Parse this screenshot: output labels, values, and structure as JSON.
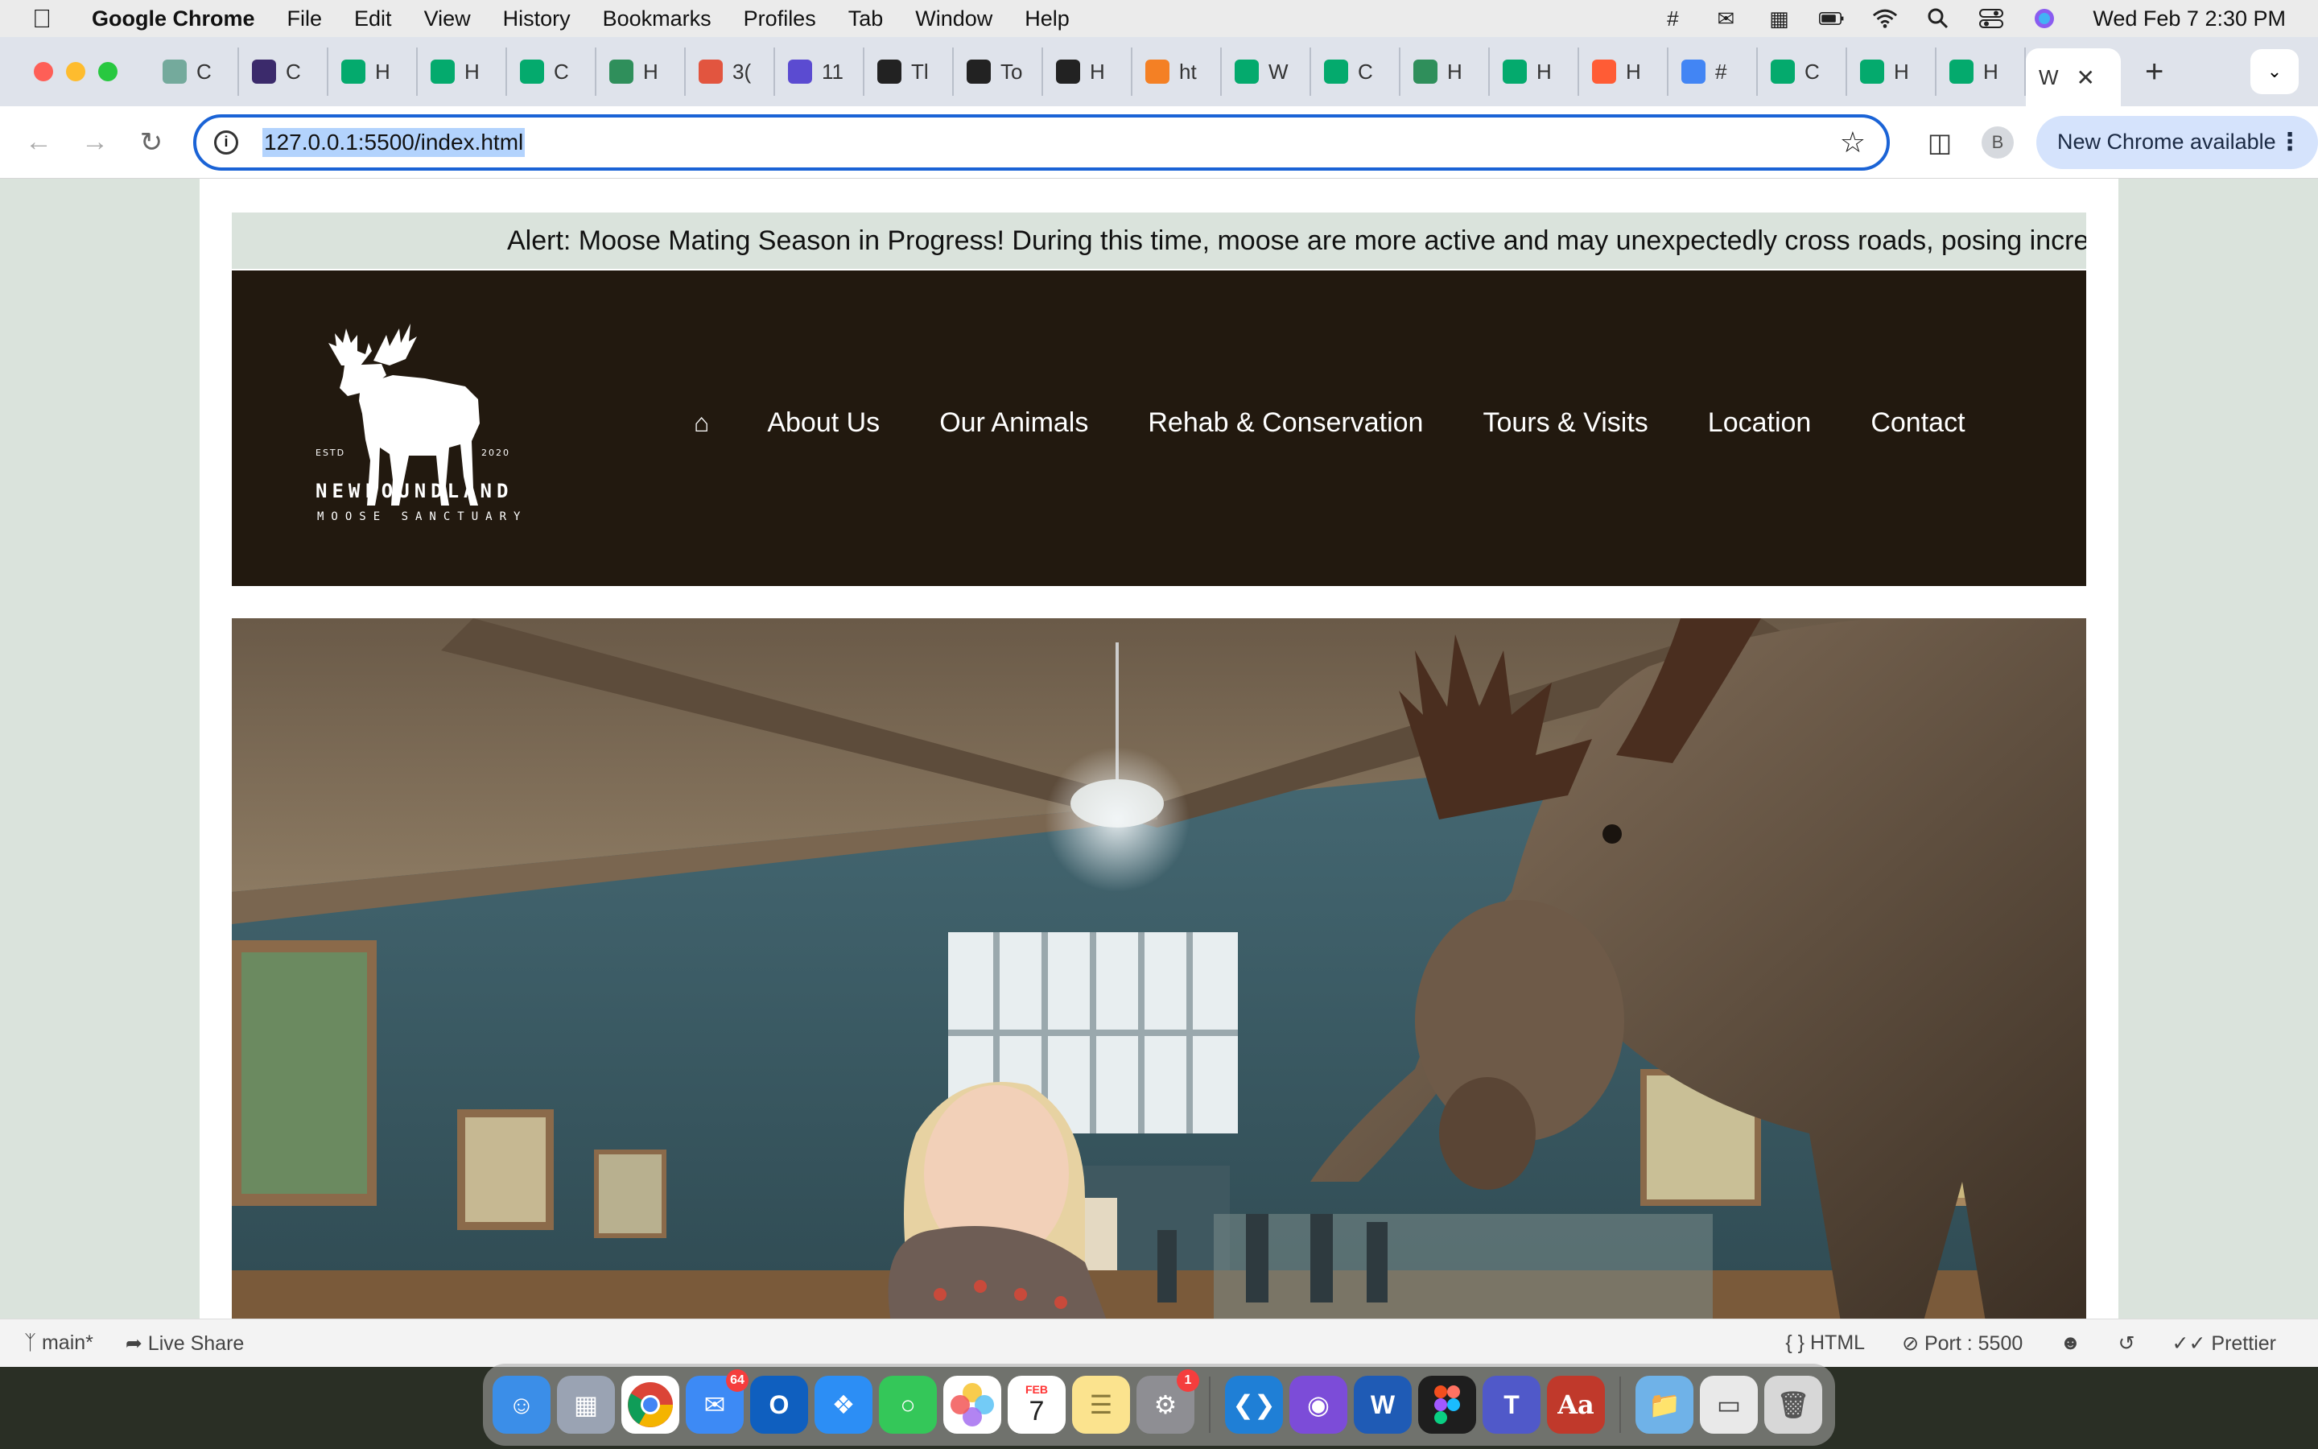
{
  "menubar": {
    "app_name": "Google Chrome",
    "items": [
      "File",
      "Edit",
      "View",
      "History",
      "Bookmarks",
      "Profiles",
      "Tab",
      "Window",
      "Help"
    ],
    "clock": "Wed Feb 7  2:30 PM"
  },
  "tabs": [
    {
      "label": "C",
      "icon": "chatgpt-icon",
      "color": "#74aa9c"
    },
    {
      "label": "C",
      "icon": "r-app-icon",
      "color": "#3b2a6b"
    },
    {
      "label": "H",
      "icon": "w3schools-icon",
      "color": "#04aa6d"
    },
    {
      "label": "H",
      "icon": "w3schools-icon",
      "color": "#04aa6d"
    },
    {
      "label": "C",
      "icon": "w3schools-icon",
      "color": "#04aa6d"
    },
    {
      "label": "H",
      "icon": "infinity-icon",
      "color": "#2f8f5b"
    },
    {
      "label": "3(",
      "icon": "colorful-icon",
      "color": "#e2553f"
    },
    {
      "label": "11",
      "icon": "h-icon",
      "color": "#5b4bd1"
    },
    {
      "label": "Tl",
      "icon": "wix-icon",
      "color": "#222222"
    },
    {
      "label": "To",
      "icon": "github-copilot-icon",
      "color": "#222222"
    },
    {
      "label": "H",
      "icon": "github-copilot-icon",
      "color": "#222222"
    },
    {
      "label": "ht",
      "icon": "stackoverflow-icon",
      "color": "#f48024"
    },
    {
      "label": "W",
      "icon": "w3schools-icon",
      "color": "#04aa6d"
    },
    {
      "label": "C",
      "icon": "w3schools-icon",
      "color": "#04aa6d"
    },
    {
      "label": "H",
      "icon": "infinity-icon",
      "color": "#2f8f5b"
    },
    {
      "label": "H",
      "icon": "w3schools-icon",
      "color": "#04aa6d"
    },
    {
      "label": "H",
      "icon": "hubspot-icon",
      "color": "#ff5c35"
    },
    {
      "label": "#",
      "icon": "google-icon",
      "color": "#4285f4"
    },
    {
      "label": "C",
      "icon": "w3schools-icon",
      "color": "#04aa6d"
    },
    {
      "label": "H",
      "icon": "w3schools-icon",
      "color": "#04aa6d"
    },
    {
      "label": "H",
      "icon": "w3schools-icon",
      "color": "#04aa6d"
    }
  ],
  "active_tab": {
    "label": "W"
  },
  "toolbar": {
    "url": "127.0.0.1:5500/index.html",
    "profile_initial": "B",
    "update_label": "New Chrome available"
  },
  "site": {
    "alert": "Alert: Moose Mating Season in Progress! During this time, moose are more active and may unexpectedly cross roads, posing incre",
    "logo": {
      "estd": "ESTD",
      "year": "2020",
      "name": "NEWFOUNDLAND",
      "sub": "MOOSE SANCTUARY"
    },
    "nav": [
      "About Us",
      "Our Animals",
      "Rehab & Conservation",
      "Tours & Visits",
      "Location",
      "Contact"
    ],
    "colors": {
      "header_bg": "#22190f",
      "alert_bg": "#dae3dc",
      "page_bg": "#dae3dc"
    }
  },
  "statusbar": {
    "branch": "main*",
    "live_share": "Live Share",
    "language": "HTML",
    "port": "Port : 5500",
    "prettier": "Prettier"
  },
  "dock": {
    "mail_badge": "64",
    "settings_badge": "1",
    "calendar_month": "FEB",
    "calendar_day": "7"
  }
}
